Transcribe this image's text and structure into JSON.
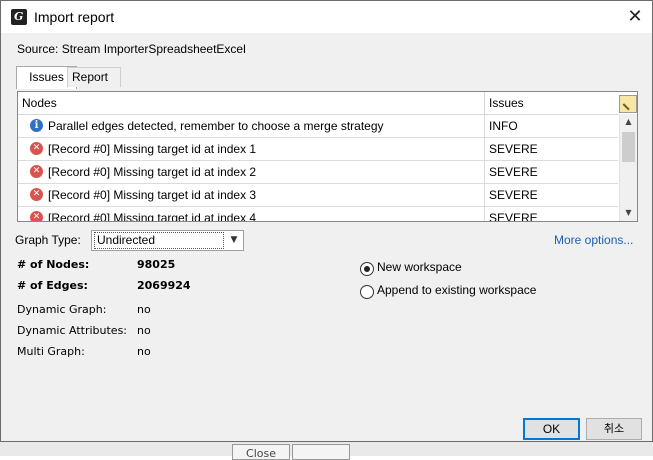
{
  "window": {
    "title": "Import report",
    "close_glyph": "✕"
  },
  "source_label": "Source:  Stream ImporterSpreadsheetExcel",
  "tabs": [
    {
      "label": "Issues",
      "active": true
    },
    {
      "label": "Report",
      "active": false
    }
  ],
  "table": {
    "columns": [
      "Nodes",
      "Issues"
    ],
    "rows": [
      {
        "icon": "info-icon",
        "node": "Parallel edges detected, remember to choose a merge strategy",
        "issue": "INFO"
      },
      {
        "icon": "error-icon",
        "node": "[Record #0] Missing target id at index 1",
        "issue": "SEVERE"
      },
      {
        "icon": "error-icon",
        "node": "[Record #0] Missing target id at index 2",
        "issue": "SEVERE"
      },
      {
        "icon": "error-icon",
        "node": "[Record #0] Missing target id at index 3",
        "issue": "SEVERE"
      },
      {
        "icon": "error-icon",
        "node": "[Record #0] Missing target id at index 4",
        "issue": "SEVERE"
      }
    ]
  },
  "graph_type": {
    "label": "Graph Type:",
    "value": "Undirected"
  },
  "more_options": "More options...",
  "stats": {
    "nodes_label": "# of Nodes:",
    "nodes_value": "98025",
    "edges_label": "# of Edges:",
    "edges_value": "2069924",
    "dynamic_graph_label": "Dynamic Graph:",
    "dynamic_graph_value": "no",
    "dynamic_attributes_label": "Dynamic Attributes:",
    "dynamic_attributes_value": "no",
    "multi_graph_label": "Multi Graph:",
    "multi_graph_value": "no"
  },
  "workspace": {
    "new_label": "New workspace",
    "append_label": "Append to existing workspace",
    "selected": "new"
  },
  "buttons": {
    "ok": "OK",
    "cancel": "취소"
  },
  "background": {
    "button_label": "Close"
  }
}
